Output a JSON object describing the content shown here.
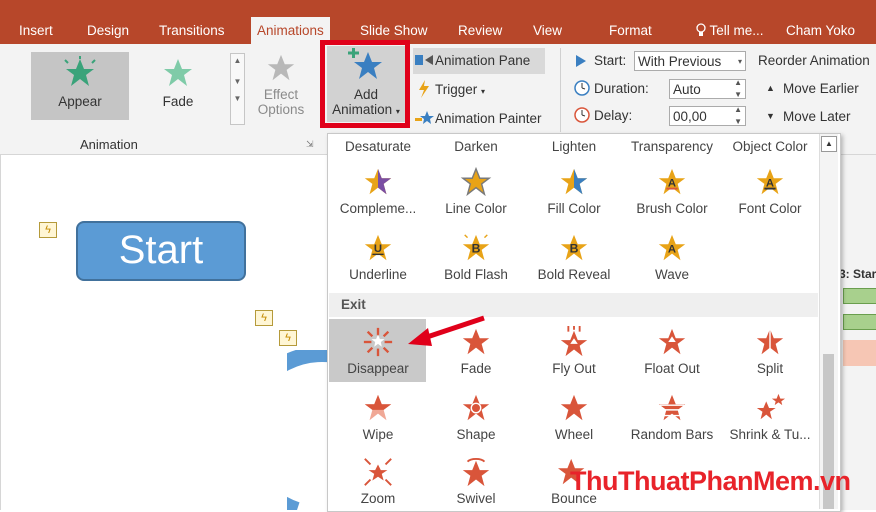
{
  "tabs": {
    "insert": "Insert",
    "design": "Design",
    "transitions": "Transitions",
    "animations": "Animations",
    "slideshow": "Slide Show",
    "review": "Review",
    "view": "View",
    "format": "Format",
    "tellme": "Tell me...",
    "user": "Cham Yoko"
  },
  "ribbon": {
    "appear": "Appear",
    "fade": "Fade",
    "effect_options_1": "Effect",
    "effect_options_2": "Options",
    "add_animation_1": "Add",
    "add_animation_2": "Animation",
    "animation_group": "Animation",
    "animation_pane": "Animation Pane",
    "trigger": "Trigger",
    "animation_painter": "Animation Painter",
    "start_label": "Start:",
    "start_value": "With Previous",
    "duration_label": "Duration:",
    "duration_value": "Auto",
    "delay_label": "Delay:",
    "delay_value": "00,00",
    "reorder": "Reorder Animation",
    "move_earlier": "Move Earlier",
    "move_later": "Move Later"
  },
  "slide": {
    "start_button": "Start"
  },
  "dropdown": {
    "top_row": [
      "Desaturate",
      "Darken",
      "Lighten",
      "Transparency",
      "Object Color"
    ],
    "emphasis_row1": [
      "Compleme...",
      "Line Color",
      "Fill Color",
      "Brush Color",
      "Font Color"
    ],
    "emphasis_row2": [
      "Underline",
      "Bold Flash",
      "Bold Reveal",
      "Wave"
    ],
    "exit_header": "Exit",
    "exit_row1": [
      "Disappear",
      "Fade",
      "Fly Out",
      "Float Out",
      "Split"
    ],
    "exit_row2": [
      "Wipe",
      "Shape",
      "Wheel",
      "Random Bars",
      "Shrink & Tu..."
    ],
    "exit_row3": [
      "Zoom",
      "Swivel",
      "Bounce"
    ]
  },
  "right": {
    "label": "3: Star"
  },
  "watermark": "ThuThuatPhanMem.vn",
  "colors": {
    "accent": "#b7472a",
    "highlight": "#e0001a",
    "start_fill": "#5b9bd5",
    "exit_star": "#d9553a"
  }
}
